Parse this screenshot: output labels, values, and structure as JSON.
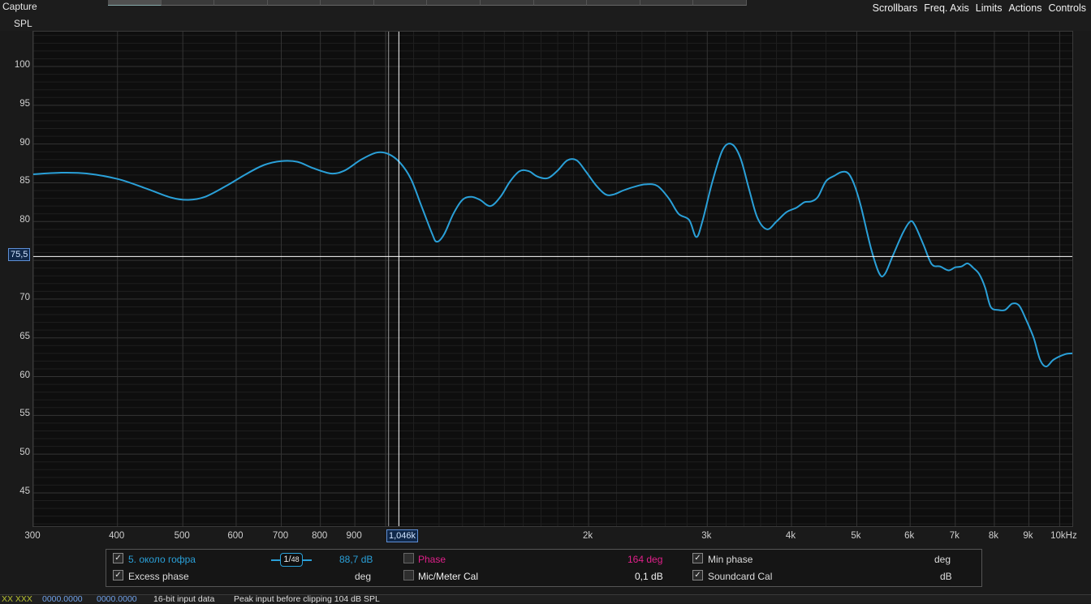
{
  "window": {
    "title": "Capture"
  },
  "menu": {
    "items": [
      "Scrollbars",
      "Freq. Axis",
      "Limits",
      "Actions",
      "Controls"
    ]
  },
  "chart_data": {
    "type": "line",
    "ylabel": "SPL",
    "xscale": "log",
    "xlim": [
      300,
      10500
    ],
    "ylim": [
      40.5,
      104.5
    ],
    "xticks": [
      {
        "v": 300,
        "label": "300"
      },
      {
        "v": 400,
        "label": "400"
      },
      {
        "v": 500,
        "label": "500"
      },
      {
        "v": 600,
        "label": "600"
      },
      {
        "v": 700,
        "label": "700"
      },
      {
        "v": 800,
        "label": "800"
      },
      {
        "v": 900,
        "label": "900"
      },
      {
        "v": 2000,
        "label": "2k"
      },
      {
        "v": 3000,
        "label": "3k"
      },
      {
        "v": 4000,
        "label": "4k"
      },
      {
        "v": 5000,
        "label": "5k"
      },
      {
        "v": 6000,
        "label": "6k"
      },
      {
        "v": 7000,
        "label": "7k"
      },
      {
        "v": 8000,
        "label": "8k"
      },
      {
        "v": 9000,
        "label": "9k"
      },
      {
        "v": 10000,
        "label": "10kHz"
      }
    ],
    "yticks": [
      45,
      50,
      55,
      60,
      65,
      70,
      75,
      80,
      85,
      90,
      95,
      100
    ],
    "grid": true,
    "series": [
      {
        "name": "5. около гофра",
        "color": "#2aa0d8",
        "points": [
          [
            300,
            86.1
          ],
          [
            330,
            86.3
          ],
          [
            360,
            86.2
          ],
          [
            400,
            85.5
          ],
          [
            440,
            84.3
          ],
          [
            480,
            83.1
          ],
          [
            510,
            82.8
          ],
          [
            540,
            83.2
          ],
          [
            580,
            84.6
          ],
          [
            620,
            86.1
          ],
          [
            660,
            87.3
          ],
          [
            700,
            87.8
          ],
          [
            740,
            87.7
          ],
          [
            780,
            86.9
          ],
          [
            830,
            86.2
          ],
          [
            870,
            86.6
          ],
          [
            920,
            88.0
          ],
          [
            970,
            88.9
          ],
          [
            1010,
            88.7
          ],
          [
            1050,
            87.6
          ],
          [
            1090,
            85.5
          ],
          [
            1130,
            82.0
          ],
          [
            1170,
            78.6
          ],
          [
            1190,
            77.4
          ],
          [
            1220,
            78.3
          ],
          [
            1260,
            81.0
          ],
          [
            1300,
            82.8
          ],
          [
            1340,
            83.2
          ],
          [
            1380,
            82.8
          ],
          [
            1430,
            82.0
          ],
          [
            1480,
            83.2
          ],
          [
            1530,
            85.2
          ],
          [
            1580,
            86.5
          ],
          [
            1630,
            86.5
          ],
          [
            1680,
            85.8
          ],
          [
            1740,
            85.6
          ],
          [
            1800,
            86.6
          ],
          [
            1860,
            87.9
          ],
          [
            1920,
            87.9
          ],
          [
            1980,
            86.5
          ],
          [
            2050,
            84.7
          ],
          [
            2120,
            83.5
          ],
          [
            2180,
            83.5
          ],
          [
            2250,
            84.0
          ],
          [
            2340,
            84.5
          ],
          [
            2430,
            84.8
          ],
          [
            2530,
            84.6
          ],
          [
            2630,
            83.0
          ],
          [
            2720,
            81.0
          ],
          [
            2820,
            80.2
          ],
          [
            2890,
            78.0
          ],
          [
            2950,
            80.0
          ],
          [
            3050,
            85.0
          ],
          [
            3160,
            89.2
          ],
          [
            3260,
            90.0
          ],
          [
            3360,
            88.2
          ],
          [
            3460,
            84.2
          ],
          [
            3560,
            80.5
          ],
          [
            3680,
            79.0
          ],
          [
            3800,
            80.0
          ],
          [
            3930,
            81.2
          ],
          [
            4070,
            81.8
          ],
          [
            4180,
            82.5
          ],
          [
            4280,
            82.6
          ],
          [
            4380,
            83.2
          ],
          [
            4500,
            85.2
          ],
          [
            4630,
            85.9
          ],
          [
            4750,
            86.4
          ],
          [
            4860,
            86.2
          ],
          [
            4960,
            84.7
          ],
          [
            5070,
            82.0
          ],
          [
            5250,
            76.5
          ],
          [
            5400,
            73.3
          ],
          [
            5500,
            73.2
          ],
          [
            5650,
            75.5
          ],
          [
            5850,
            78.5
          ],
          [
            6000,
            80.0
          ],
          [
            6100,
            79.5
          ],
          [
            6280,
            77.0
          ],
          [
            6460,
            74.5
          ],
          [
            6650,
            74.2
          ],
          [
            6840,
            73.7
          ],
          [
            7000,
            74.1
          ],
          [
            7150,
            74.2
          ],
          [
            7300,
            74.6
          ],
          [
            7450,
            74.0
          ],
          [
            7600,
            73.2
          ],
          [
            7750,
            71.5
          ],
          [
            7900,
            69.0
          ],
          [
            8100,
            68.6
          ],
          [
            8300,
            68.6
          ],
          [
            8500,
            69.4
          ],
          [
            8700,
            69.2
          ],
          [
            8900,
            67.5
          ],
          [
            9150,
            65.0
          ],
          [
            9350,
            62.2
          ],
          [
            9550,
            61.3
          ],
          [
            9800,
            62.2
          ],
          [
            10200,
            62.9
          ],
          [
            10500,
            63.0
          ]
        ]
      }
    ],
    "cursor": {
      "x": 1046,
      "x_label": "1,046k",
      "y": 75.5,
      "y_label": "75,5"
    },
    "marker": {
      "x": 1010
    }
  },
  "legend": {
    "r1c1": {
      "label": "5. около гофра",
      "value": "88,7 dB",
      "checked": true,
      "color": "#2aa0d8"
    },
    "smoothing": {
      "prefix": "1/",
      "value": "48"
    },
    "r2c1": {
      "label": "Excess phase",
      "value": "deg",
      "checked": true
    },
    "r1c2": {
      "label": "Phase",
      "value": "164 deg",
      "checked": false,
      "color": "#e0208a"
    },
    "r2c2": {
      "label": "Mic/Meter Cal",
      "value": "0,1 dB",
      "checked": false
    },
    "r1c3": {
      "label": "Min phase",
      "value": "deg",
      "checked": true
    },
    "r2c3": {
      "label": "Soundcard Cal",
      "value": "dB",
      "checked": true
    }
  },
  "status": {
    "levels": "XX XXX",
    "readout1": "0000.0000",
    "readout2": "0000.0000",
    "input_bits": "16-bit input data",
    "peak": "Peak input before clipping 104 dB SPL"
  }
}
